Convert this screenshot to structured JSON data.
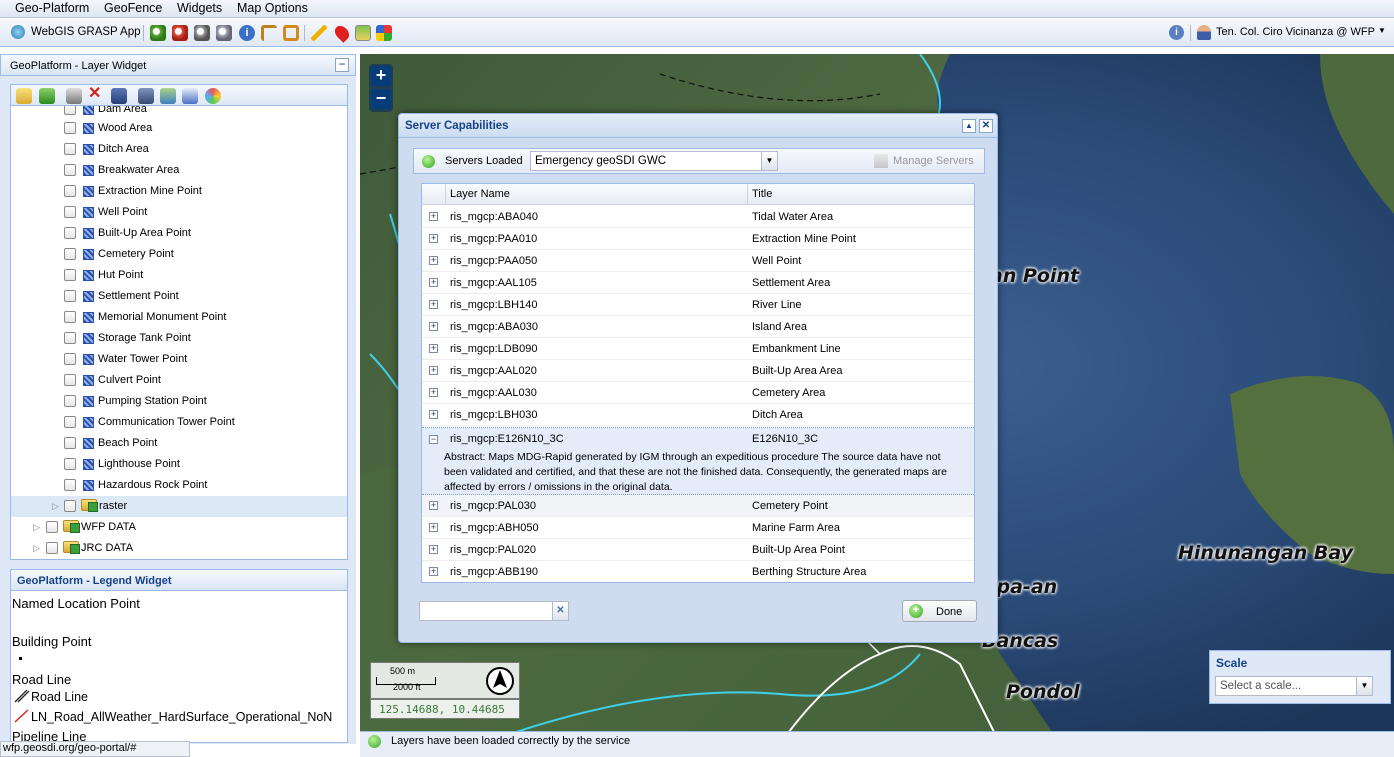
{
  "menu": {
    "items": [
      "Geo-Platform",
      "GeoFence",
      "Widgets",
      "Map Options"
    ]
  },
  "toolbar": {
    "app_name": "WebGIS GRASP App",
    "user": "Ten. Col. Ciro Vicinanza @ WFP"
  },
  "layer_widget": {
    "title": "GeoPlatform - Layer Widget",
    "partial_item": "Dam Area",
    "layers": [
      "Wood Area",
      "Ditch Area",
      "Breakwater Area",
      "Extraction Mine Point",
      "Well Point",
      "Built-Up Area Point",
      "Cemetery Point",
      "Hut Point",
      "Settlement Point",
      "Memorial Monument Point",
      "Storage Tank Point",
      "Water Tower Point",
      "Culvert Point",
      "Pumping Station Point",
      "Communication Tower Point",
      "Beach Point",
      "Lighthouse Point",
      "Hazardous Rock Point"
    ],
    "folders": [
      {
        "label": "raster"
      },
      {
        "label": "WFP DATA"
      },
      {
        "label": "JRC DATA"
      }
    ]
  },
  "legend_widget": {
    "title": "GeoPlatform - Legend Widget",
    "items": [
      "Named Location Point",
      "Building Point",
      "Road Line",
      "Road Line",
      "LN_Road_AllWeather_HardSurface_Operational_NoN",
      "Pipeline Line"
    ]
  },
  "map": {
    "labels": [
      "an Point",
      "Hinunangan Bay",
      "ipa-an",
      "Bancas",
      "Pondol"
    ],
    "zoom_in": "+",
    "zoom_out": "−",
    "scale_line_m": "500 m",
    "scale_line_ft": "2000 ft",
    "coords": "125.14688, 10.44685",
    "scale_panel": {
      "title": "Scale",
      "placeholder": "Select a scale..."
    }
  },
  "dialog": {
    "title": "Server Capabilities",
    "servers_label": "Servers Loaded",
    "server_selected": "Emergency geoSDI GWC",
    "manage_label": "Manage Servers",
    "col_name": "Layer Name",
    "col_title": "Title",
    "rows": [
      {
        "name": "ris_mgcp:ABA040",
        "title": "Tidal Water Area"
      },
      {
        "name": "ris_mgcp:PAA010",
        "title": "Extraction Mine Point"
      },
      {
        "name": "ris_mgcp:PAA050",
        "title": "Well Point"
      },
      {
        "name": "ris_mgcp:AAL105",
        "title": "Settlement Area"
      },
      {
        "name": "ris_mgcp:LBH140",
        "title": "River Line"
      },
      {
        "name": "ris_mgcp:ABA030",
        "title": "Island Area"
      },
      {
        "name": "ris_mgcp:LDB090",
        "title": "Embankment Line"
      },
      {
        "name": "ris_mgcp:AAL020",
        "title": "Built-Up Area Area"
      },
      {
        "name": "ris_mgcp:AAL030",
        "title": "Cemetery Area"
      },
      {
        "name": "ris_mgcp:LBH030",
        "title": "Ditch Area"
      }
    ],
    "expanded": {
      "name": "ris_mgcp:E126N10_3C",
      "title": "E126N10_3C",
      "abstract_label": "Abstract:",
      "abstract_line1": "Maps MDG-Rapid generated by IGM through an expeditious procedure The source data have not",
      "abstract_line2": "been validated and certified, and that these are not the finished data. Consequently, the generated maps are",
      "abstract_line3": "affected by errors / omissions in the original data."
    },
    "rows2": [
      {
        "name": "ris_mgcp:PAL030",
        "title": "Cemetery Point"
      },
      {
        "name": "ris_mgcp:ABH050",
        "title": "Marine Farm Area"
      },
      {
        "name": "ris_mgcp:PAL020",
        "title": "Built-Up Area Point"
      },
      {
        "name": "ris_mgcp:ABB190",
        "title": "Berthing Structure Area"
      }
    ],
    "search_value": "",
    "done_label": "Done"
  },
  "status": {
    "message": "Layers have been loaded correctly by the service",
    "url": "wfp.geosdi.org/geo-portal/#"
  }
}
